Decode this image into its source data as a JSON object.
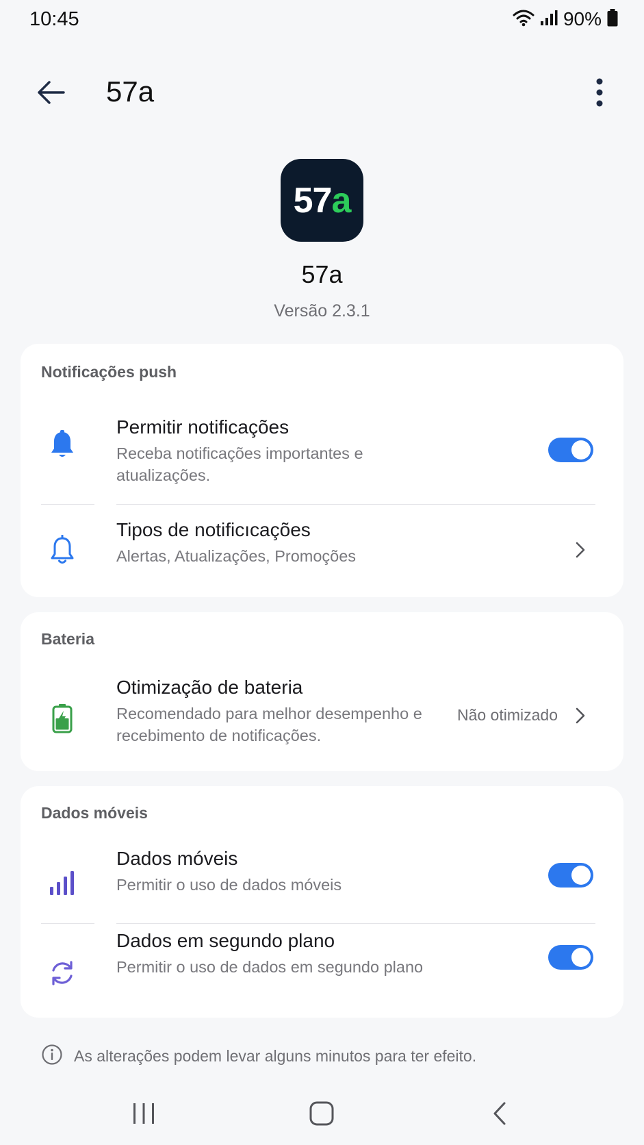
{
  "status_bar": {
    "time": "10:45",
    "battery_pct": "90%"
  },
  "app_bar": {
    "title": "57a"
  },
  "app": {
    "icon_text_white": "57",
    "icon_text_green": "a",
    "name": "57a",
    "version": "Versão 2.3.1"
  },
  "push_section": {
    "title": "Notificações push",
    "allow": {
      "title": "Permitir notificações",
      "subtitle": "Receba notificações importantes e atualizações.",
      "enabled": true
    },
    "types": {
      "title": "Tipos de notificıcações",
      "subtitle": "Alertas, Atualizações, Promoções"
    }
  },
  "battery_section": {
    "title": "Bateria",
    "optimization": {
      "title": "Otimização de bateria",
      "subtitle": "Recomendado para melhor desempenho e recebimento de notificações.",
      "value": "Não otimizado"
    }
  },
  "data_section": {
    "title": "Dados móveis",
    "mobile": {
      "title": "Dados móveis",
      "subtitle": "Permitir o uso de dados móveis",
      "enabled": true
    },
    "background": {
      "title": "Dados em segundo plano",
      "subtitle": "Permitir o uso de dados em segundo plano",
      "enabled": true
    }
  },
  "note": "As alterações podem levar alguns minutos para ter efeito.",
  "colors": {
    "accent": "#2c78ee",
    "icon_bg": "#0c1a2c",
    "icon_green": "#2dcc5a",
    "battery_green": "#3aa04a",
    "purple": "#5b4fc9"
  }
}
